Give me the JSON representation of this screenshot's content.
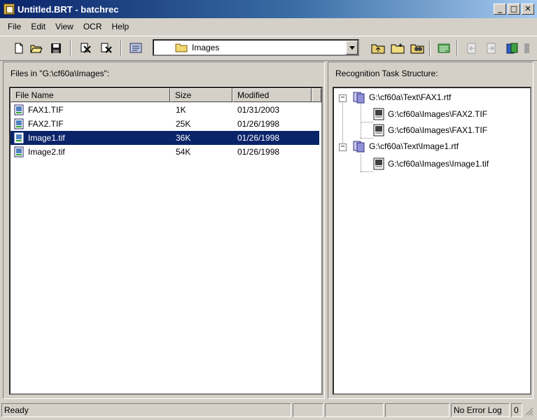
{
  "window": {
    "title": "Untitled.BRT - batchrec",
    "caption_buttons": [
      "_",
      "□",
      "✕"
    ]
  },
  "menu": [
    "File",
    "Edit",
    "View",
    "OCR",
    "Help"
  ],
  "toolbar": {
    "folder_combo_value": "Images",
    "icons": [
      "new-icon",
      "open-icon",
      "save-icon",
      "cut-icon",
      "delete-icon",
      "scan-icon",
      "folder-up-icon",
      "folder-new-icon",
      "find-icon",
      "options-icon",
      "back-icon",
      "forward-icon",
      "run-icon"
    ]
  },
  "files_panel": {
    "label": "Files in \"G:\\cf60a\\Images\":",
    "columns": [
      "File Name",
      "Size",
      "Modified"
    ],
    "rows": [
      {
        "name": "FAX1.TIF",
        "size": "1K",
        "modified": "01/31/2003",
        "selected": false
      },
      {
        "name": "FAX2.TIF",
        "size": "25K",
        "modified": "01/26/1998",
        "selected": false
      },
      {
        "name": "Image1.tif",
        "size": "36K",
        "modified": "01/26/1998",
        "selected": true
      },
      {
        "name": "Image2.tif",
        "size": "54K",
        "modified": "01/26/1998",
        "selected": false
      }
    ]
  },
  "task_panel": {
    "label": "Recognition Task Structure:",
    "nodes": [
      {
        "label": "G:\\cf60a\\Text\\FAX1.rtf",
        "children": [
          "G:\\cf60a\\Images\\FAX2.TIF",
          "G:\\cf60a\\Images\\FAX1.TIF"
        ]
      },
      {
        "label": "G:\\cf60a\\Text\\Image1.rtf",
        "children": [
          "G:\\cf60a\\Images\\Image1.tif"
        ]
      }
    ]
  },
  "status": {
    "text": "Ready",
    "error_log": "No Error Log",
    "count": "0"
  },
  "colors": {
    "selection": "#0a246a",
    "title_gradient_start": "#0a246a",
    "face": "#d4d0c8"
  }
}
